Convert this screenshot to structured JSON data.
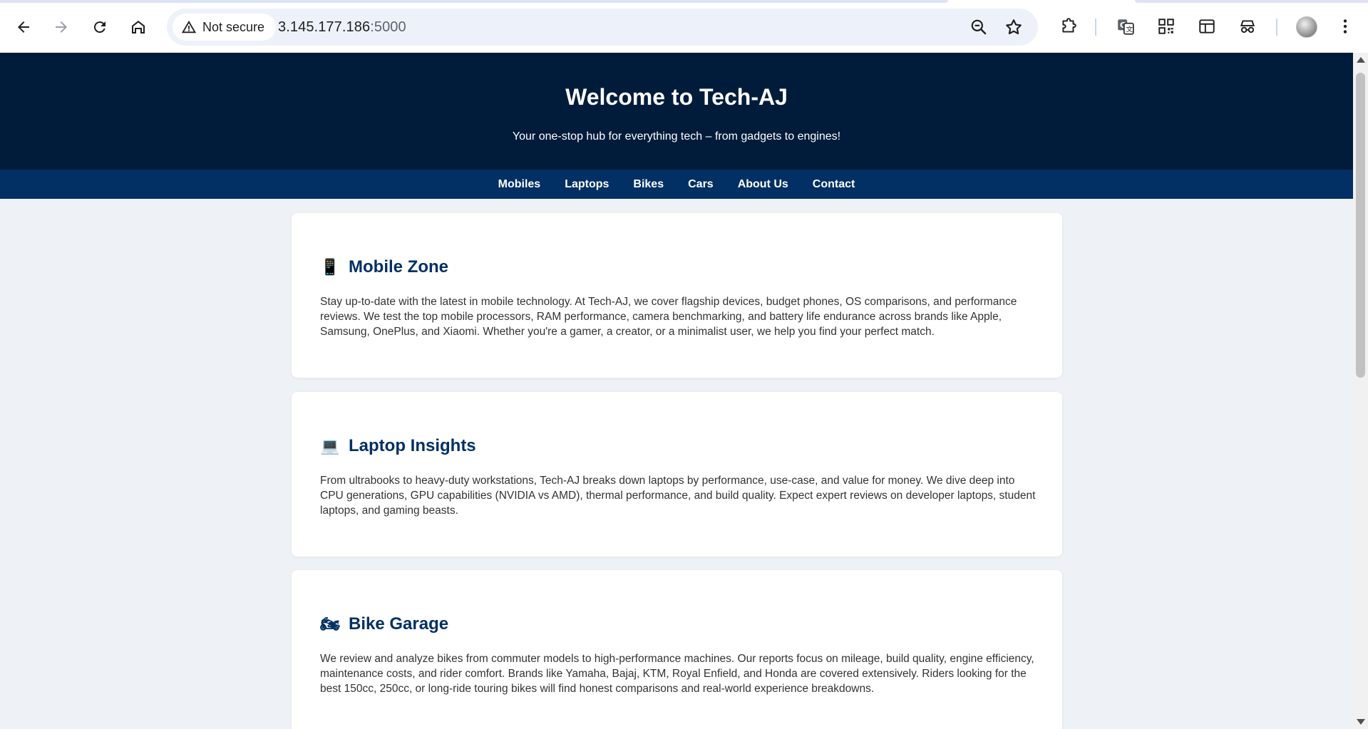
{
  "browser": {
    "security_label": "Not secure",
    "url_host": "3.145.177.186",
    "url_port": ":5000",
    "icons": [
      "back-icon",
      "forward-icon",
      "reload-icon",
      "home-icon",
      "warning-icon",
      "zoom-icon",
      "star-icon",
      "extensions-icon",
      "translate-icon",
      "qr-code-icon",
      "side-panel-icon",
      "incognito-icon",
      "profile-avatar",
      "more-menu-icon"
    ]
  },
  "site": {
    "title": "Welcome to Tech-AJ",
    "tagline": "Your one-stop hub for everything tech – from gadgets to engines!",
    "nav": [
      "Mobiles",
      "Laptops",
      "Bikes",
      "Cars",
      "About Us",
      "Contact"
    ]
  },
  "sections": [
    {
      "emoji": "📱",
      "heading": "Mobile Zone",
      "body": "Stay up-to-date with the latest in mobile technology. At Tech-AJ, we cover flagship devices, budget phones, OS comparisons, and performance reviews. We test the top mobile processors, RAM performance, camera benchmarking, and battery life endurance across brands like Apple, Samsung, OnePlus, and Xiaomi. Whether you're a gamer, a creator, or a minimalist user, we help you find your perfect match."
    },
    {
      "emoji": "💻",
      "heading": "Laptop Insights",
      "body": "From ultrabooks to heavy-duty workstations, Tech-AJ breaks down laptops by performance, use-case, and value for money. We dive deep into CPU generations, GPU capabilities (NVIDIA vs AMD), thermal performance, and build quality. Expect expert reviews on developer laptops, student laptops, and gaming beasts."
    },
    {
      "emoji": "🏍",
      "heading": "Bike Garage",
      "body": "We review and analyze bikes from commuter models to high-performance machines. Our reports focus on mileage, build quality, engine efficiency, maintenance costs, and rider comfort. Brands like Yamaha, Bajaj, KTM, Royal Enfield, and Honda are covered extensively. Riders looking for the best 150cc, 250cc, or long-ride touring bikes will find honest comparisons and real-world experience breakdowns."
    }
  ],
  "colors": {
    "header_bg": "#011c3b",
    "nav_bg": "#023064",
    "heading": "#023064",
    "page_bg": "#eef1f5"
  }
}
